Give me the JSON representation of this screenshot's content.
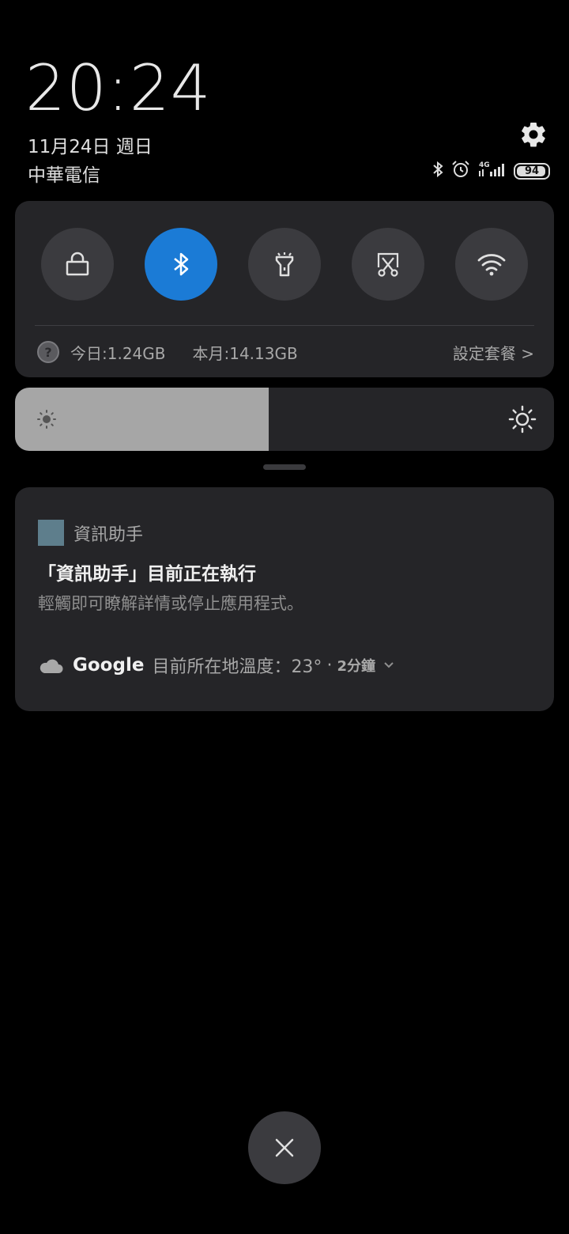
{
  "status": {
    "time": "20:24",
    "date": "11月24日 週日",
    "carrier": "中華電信",
    "battery_level": "94",
    "battery_fraction": 0.94,
    "network": "4G",
    "icons": [
      "bluetooth-icon",
      "alarm-icon",
      "signal-icon",
      "battery-icon"
    ]
  },
  "quick_settings": {
    "tiles": [
      {
        "name": "lock",
        "icon": "lock-icon",
        "active": false
      },
      {
        "name": "bluetooth",
        "icon": "bluetooth-icon",
        "active": true
      },
      {
        "name": "flashlight",
        "icon": "flashlight-icon",
        "active": false
      },
      {
        "name": "screenshot",
        "icon": "screenshot-icon",
        "active": false
      },
      {
        "name": "wifi",
        "icon": "wifi-icon",
        "active": false
      }
    ],
    "data_usage": {
      "today": "今日:1.24GB",
      "month": "本月:14.13GB",
      "plan_link": "設定套餐 >"
    },
    "active_color": "#1b7bd6"
  },
  "brightness": {
    "level": 0.47
  },
  "notifications": [
    {
      "app_name": "資訊助手",
      "title": "「資訊助手」目前正在執行",
      "body": "輕觸即可瞭解詳情或停止應用程式。"
    }
  ],
  "weather": {
    "source": "Google",
    "text": "目前所在地溫度：23°",
    "dot": "·",
    "time": "2分鐘"
  }
}
